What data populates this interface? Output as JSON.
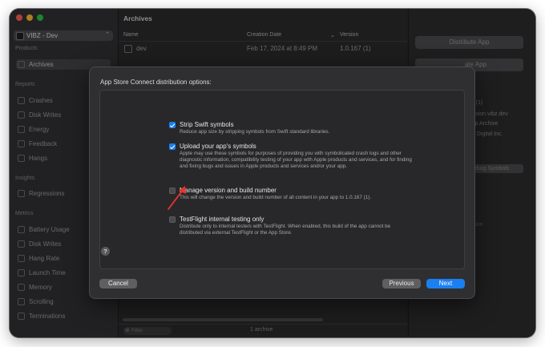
{
  "colors": {
    "traffic_red": "#ff5f57",
    "traffic_yellow": "#febc2e",
    "traffic_green": "#28c840",
    "accent": "#1a7ff0"
  },
  "sidebar": {
    "scheme": "VIBZ - Dev",
    "sections": {
      "products": "Products",
      "reports": "Reports",
      "insights": "Insights",
      "metrics": "Metrics"
    },
    "products_items": [
      "Archives"
    ],
    "reports_items": [
      "Crashes",
      "Disk Writes",
      "Energy",
      "Feedback",
      "Hangs"
    ],
    "insights_items": [
      "Regressions"
    ],
    "metrics_items": [
      "Battery Usage",
      "Disk Writes",
      "Hang Rate",
      "Launch Time",
      "Memory",
      "Scrolling",
      "Terminations"
    ]
  },
  "archives": {
    "title": "Archives",
    "columns": {
      "name": "Name",
      "creation_date": "Creation Date",
      "version": "Version"
    },
    "row": {
      "name": "dev",
      "date": "Feb 17, 2024 at 8:49 PM",
      "version": "1.0.167 (1)"
    },
    "filter_placeholder": "Filter",
    "count": "1 archive"
  },
  "inspector": {
    "distribute_button": "Distribute App",
    "validate_button": "ate App",
    "version_value": "167 (1)",
    "identifier_value": ".passion.vibz.dev",
    "type_value": "App Archive",
    "team_value": "sion Digital Inc.",
    "arch_value": "64",
    "debug_button": "ebug Symbols",
    "description_placeholder": "cription"
  },
  "dialog": {
    "title": "App Store Connect distribution options:",
    "options": [
      {
        "title": "Strip Swift symbols",
        "checked": true,
        "description": "Reduce app size by stripping symbols from Swift standard libraries."
      },
      {
        "title": "Upload your app's symbols",
        "checked": true,
        "description": "Apple may use these symbols for purposes of providing you with symbolicated crash logs and other diagnostic information, compatibility testing of your app with Apple products and services, and for finding and fixing bugs and issues in Apple products and services and/or your app."
      },
      {
        "title": "Manage version and build number",
        "checked": false,
        "description": "This will change the version and build number of all content in your app to 1.0.167 (1)."
      },
      {
        "title": "TestFlight internal testing only",
        "checked": false,
        "description": "Distribute only to internal testers with TestFlight. When enabled, this build of the app cannot be distributed via external TestFlight or the App Store."
      }
    ],
    "help_label": "?",
    "cancel_label": "Cancel",
    "previous_label": "Previous",
    "next_label": "Next"
  }
}
